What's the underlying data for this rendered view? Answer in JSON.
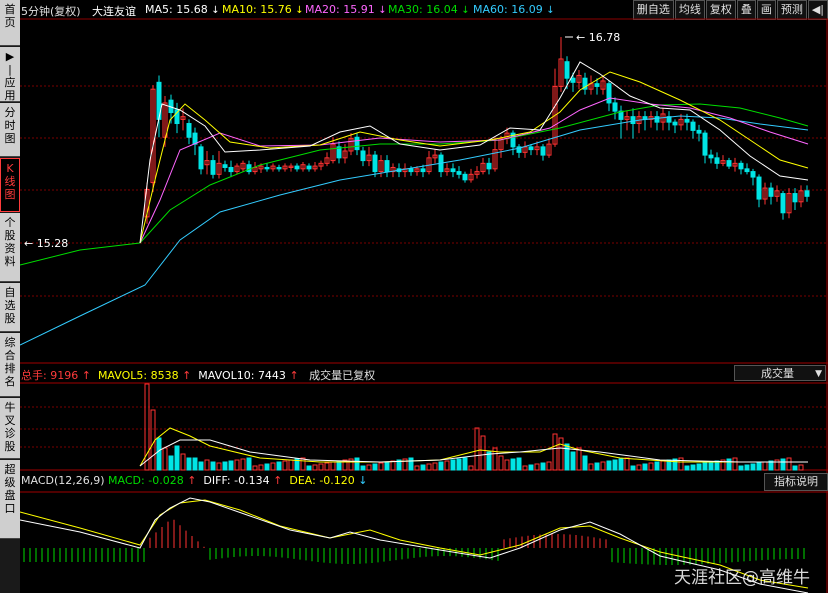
{
  "sidebar": [
    {
      "label": "首页",
      "active": false
    },
    {
      "label": "▶|应用",
      "active": false
    },
    {
      "label": "分时图",
      "active": false
    },
    {
      "label": "K线图",
      "active": true
    },
    {
      "label": "个股资料",
      "active": false
    },
    {
      "label": "自选股",
      "active": false
    },
    {
      "label": "综合排名",
      "active": false
    },
    {
      "label": "牛叉诊股",
      "active": false
    },
    {
      "label": "超级盘口",
      "active": false
    }
  ],
  "header": {
    "period": "5分钟(复权)",
    "stock_name": "大连友谊",
    "ma5": {
      "label": "MA5:",
      "value": "15.68",
      "arrow": "↓",
      "color": "#ffffff"
    },
    "ma10": {
      "label": "MA10:",
      "value": "15.76",
      "arrow": "↓",
      "color": "#ffff00"
    },
    "ma20": {
      "label": "MA20:",
      "value": "15.91",
      "arrow": "↓",
      "color": "#ff66ff"
    },
    "ma30": {
      "label": "MA30:",
      "value": "16.04",
      "arrow": "↓",
      "color": "#00dd00"
    },
    "ma60": {
      "label": "MA60:",
      "value": "16.09",
      "arrow": "↓",
      "color": "#33ccff"
    }
  },
  "toolbar": [
    "删自选",
    "均线",
    "复权",
    "叠",
    "画",
    "预测",
    "◀|"
  ],
  "price_annotations": {
    "high": "16.78",
    "low": "15.28"
  },
  "volume_panel": {
    "total_label": "总手:",
    "total_value": "9196",
    "total_arrow": "↑",
    "mavol5_label": "MAVOL5:",
    "mavol5_value": "8538",
    "mavol5_arrow": "↑",
    "mavol10_label": "MAVOL10:",
    "mavol10_value": "7443",
    "mavol10_arrow": "↑",
    "note": "成交量已复权",
    "dropdown": "成交量"
  },
  "macd_panel": {
    "title": "MACD(12,26,9)",
    "macd_label": "MACD:",
    "macd_value": "-0.028",
    "macd_arrow": "↑",
    "diff_label": "DIFF:",
    "diff_value": "-0.134",
    "diff_arrow": "↑",
    "dea_label": "DEA:",
    "dea_value": "-0.120",
    "dea_arrow": "↓",
    "dropdown": "指标说明"
  },
  "watermark": "天涯社区@高维牛",
  "colors": {
    "up": "#ff3232",
    "down": "#00e5e5",
    "grid": "#7a0000",
    "label_red": "#ff3b3b"
  }
}
